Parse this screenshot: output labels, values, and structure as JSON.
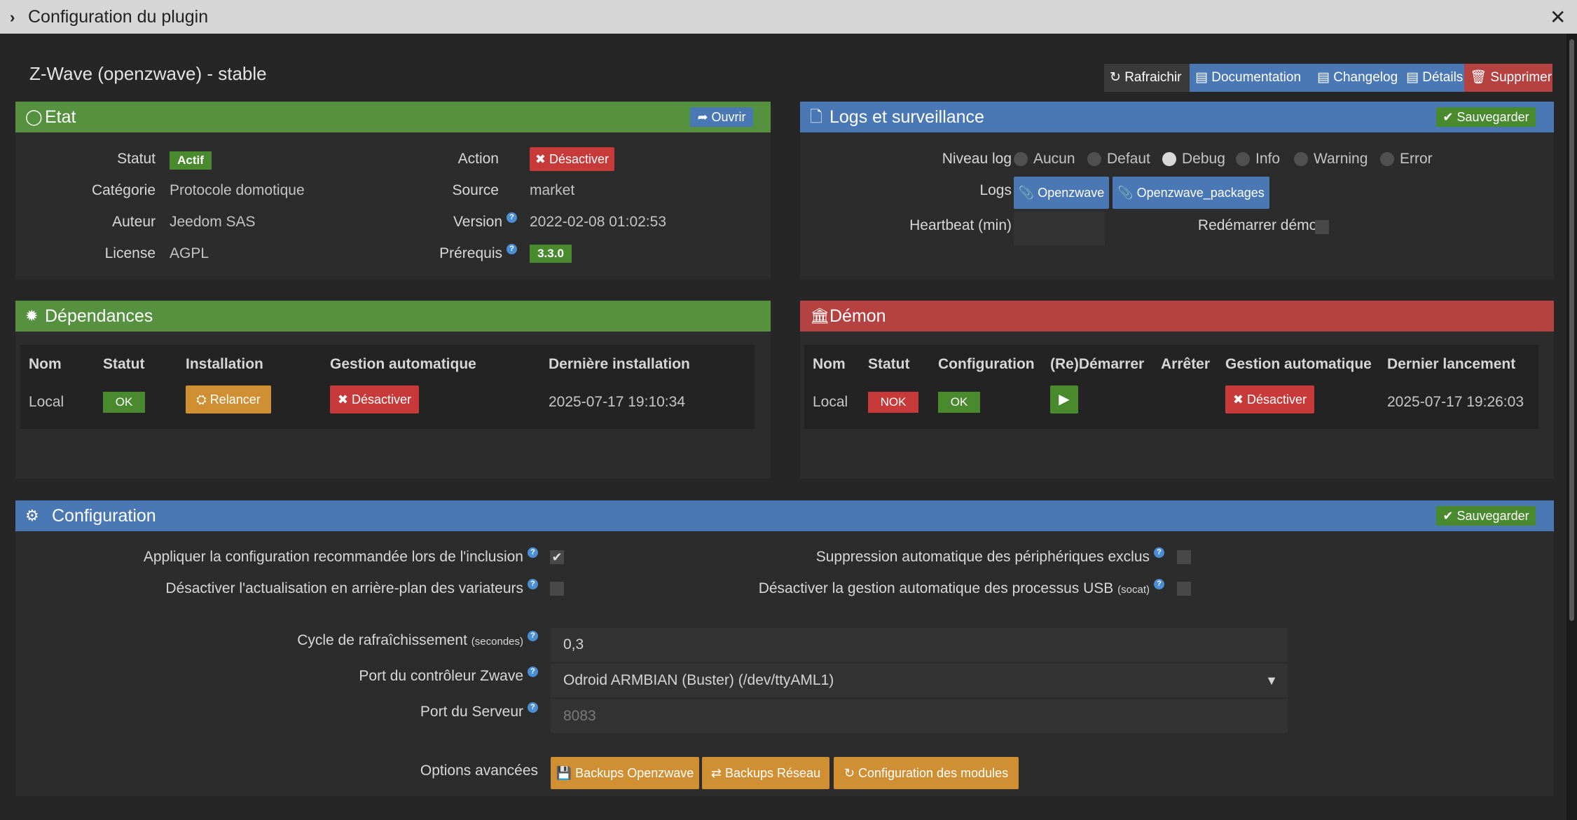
{
  "window": {
    "title": "Configuration du plugin"
  },
  "plugin": {
    "title": "Z-Wave (openzwave) - stable"
  },
  "header_buttons": [
    {
      "label": "Rafraichir"
    },
    {
      "label": "Documentation"
    },
    {
      "label": "Changelog"
    },
    {
      "label": "Détails"
    },
    {
      "label": "Supprimer"
    }
  ],
  "etat": {
    "title": "Etat",
    "open_label": "Ouvrir",
    "statut_label": "Statut",
    "statut_value": "Actif",
    "categorie_label": "Catégorie",
    "categorie_value": "Protocole domotique",
    "auteur_label": "Auteur",
    "auteur_value": "Jeedom SAS",
    "license_label": "License",
    "license_value": "AGPL",
    "action_label": "Action",
    "action_button": "Désactiver",
    "source_label": "Source",
    "source_value": "market",
    "version_label": "Version",
    "version_value": "2022-02-08 01:02:53",
    "prerequis_label": "Prérequis",
    "prerequis_value": "3.3.0"
  },
  "logs": {
    "title": "Logs et surveillance",
    "save_label": "Sauvegarder",
    "niveau_label": "Niveau log",
    "levels": [
      {
        "label": "Aucun",
        "selected": false
      },
      {
        "label": "Defaut",
        "selected": false
      },
      {
        "label": "Debug",
        "selected": true
      },
      {
        "label": "Info",
        "selected": false
      },
      {
        "label": "Warning",
        "selected": false
      },
      {
        "label": "Error",
        "selected": false
      }
    ],
    "logs_label": "Logs",
    "log_buttons": [
      "Openzwave",
      "Openzwave_packages"
    ],
    "heartbeat_label": "Heartbeat (min)",
    "heartbeat_value": "",
    "restart_label": "Redémarrer démon"
  },
  "dependances": {
    "title": "Dépendances",
    "headers": [
      "Nom",
      "Statut",
      "Installation",
      "Gestion automatique",
      "Dernière installation"
    ],
    "row": {
      "nom": "Local",
      "statut": "OK",
      "installation": "Relancer",
      "gestion": "Désactiver",
      "derniere": "2025-07-17 19:10:34"
    }
  },
  "demon": {
    "title": "Démon",
    "headers": [
      "Nom",
      "Statut",
      "Configuration",
      "(Re)Démarrer",
      "Arrêter",
      "Gestion automatique",
      "Dernier lancement"
    ],
    "row": {
      "nom": "Local",
      "statut": "NOK",
      "configuration": "OK",
      "gestion": "Désactiver",
      "dernier": "2025-07-17 19:26:03"
    }
  },
  "configuration": {
    "title": "Configuration",
    "save_label": "Sauvegarder",
    "opt1": {
      "label": "Appliquer la configuration recommandée lors de l'inclusion",
      "checked": true
    },
    "opt2": {
      "label": "Désactiver l'actualisation en arrière-plan des variateurs",
      "checked": false
    },
    "opt3": {
      "label": "Suppression automatique des périphériques exclus",
      "checked": false
    },
    "opt4": {
      "label": "Désactiver la gestion automatique des processus USB",
      "suffix": "(socat)",
      "checked": false
    },
    "cycle_label": "Cycle de rafraîchissement",
    "cycle_suffix": "(secondes)",
    "cycle_value": "0,3",
    "port_label": "Port du contrôleur Zwave",
    "port_value": "Odroid ARMBIAN (Buster) (/dev/ttyAML1)",
    "serveur_label": "Port du Serveur",
    "serveur_placeholder": "8083",
    "options_label": "Options avancées",
    "option_buttons": [
      "Backups Openzwave",
      "Backups Réseau",
      "Configuration des modules"
    ]
  },
  "colors": {
    "green": "#55913e",
    "blue": "#4a78b5",
    "red": "#b54141",
    "orange": "#d08f32",
    "dark": "#262626"
  }
}
